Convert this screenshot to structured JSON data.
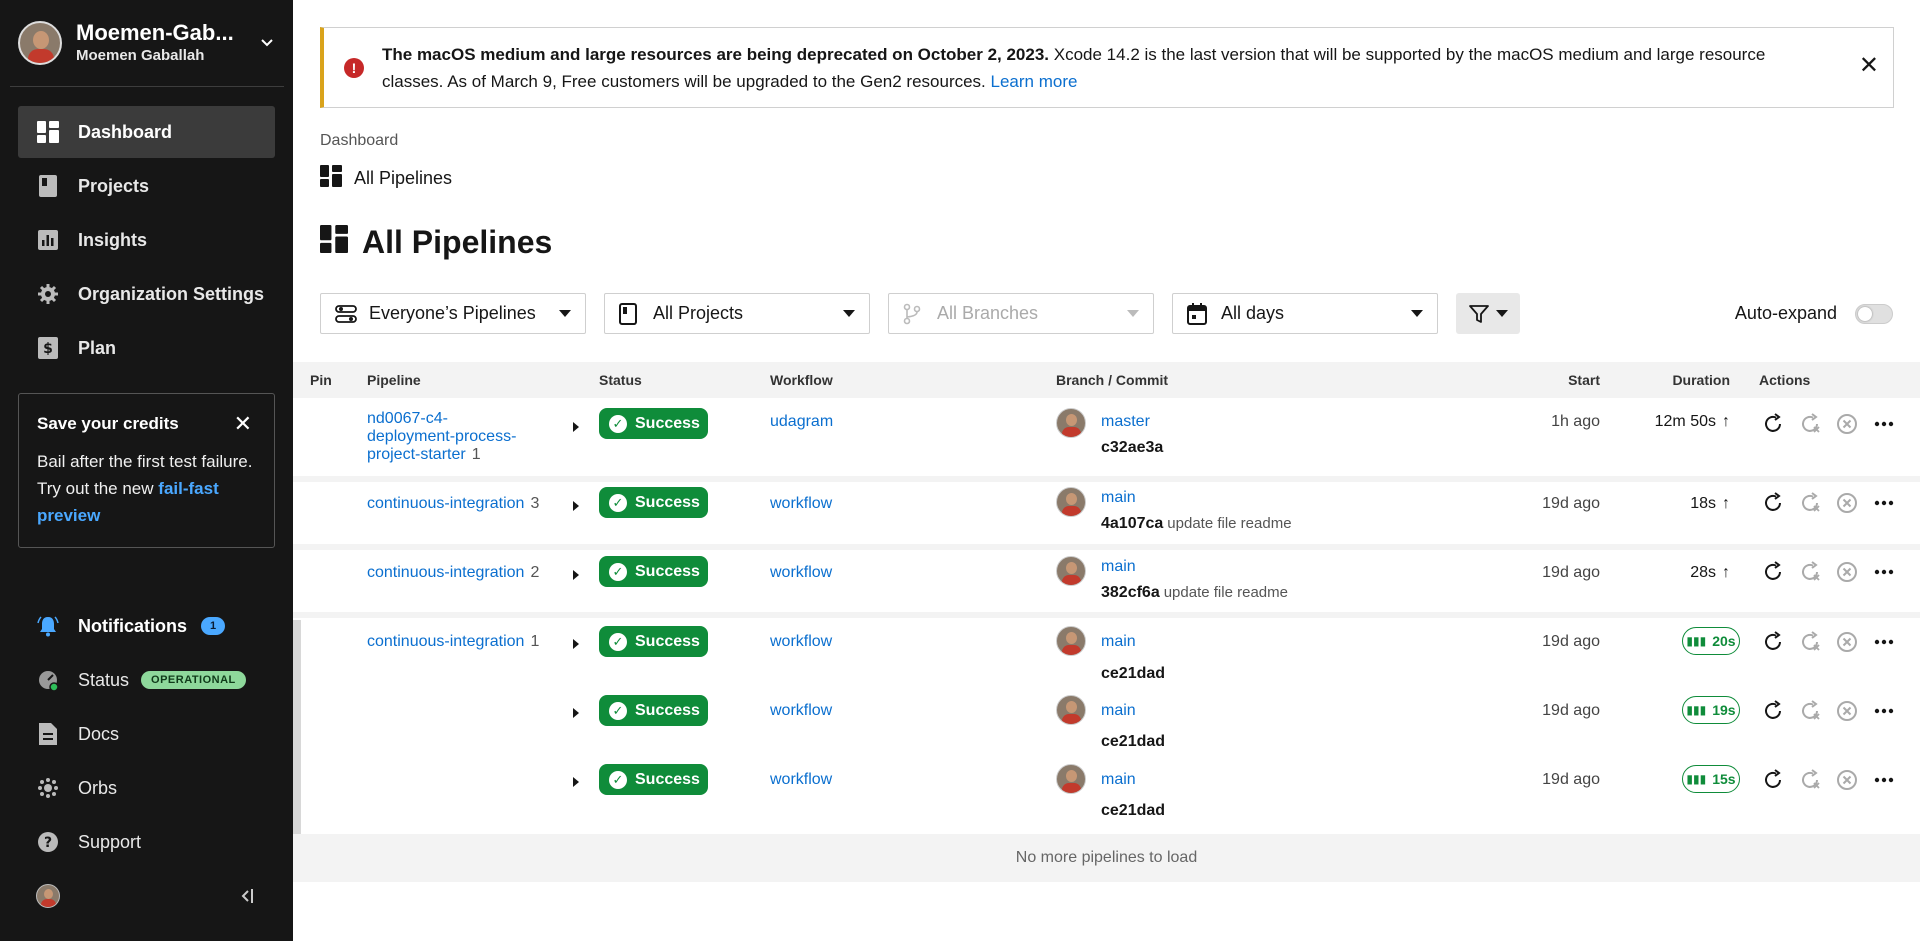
{
  "sidebar": {
    "org_name": "Moemen-Gab...",
    "user_name": "Moemen Gaballah",
    "nav": [
      {
        "label": "Dashboard",
        "icon": "dashboard-icon"
      },
      {
        "label": "Projects",
        "icon": "projects-icon"
      },
      {
        "label": "Insights",
        "icon": "insights-icon"
      },
      {
        "label": "Organization Settings",
        "icon": "gear-icon"
      },
      {
        "label": "Plan",
        "icon": "dollar-icon"
      }
    ],
    "credits": {
      "title": "Save your credits",
      "body": "Bail after the first test failure. Try out the new",
      "link": "fail-fast preview"
    },
    "bottom_nav": [
      {
        "label": "Notifications",
        "count": "1"
      },
      {
        "label": "Status",
        "badge": "OPERATIONAL"
      },
      {
        "label": "Docs"
      },
      {
        "label": "Orbs"
      },
      {
        "label": "Support"
      }
    ]
  },
  "banner": {
    "bold": "The macOS medium and large resources are being deprecated on October 2, 2023.",
    "text": " Xcode 14.2 is the last version that will be supported by the macOS medium and large resource classes. As of March 9, Free customers will be upgraded to the Gen2 resources. ",
    "link": "Learn more"
  },
  "breadcrumb": "Dashboard",
  "subtitle": "All Pipelines",
  "title": "All Pipelines",
  "filters": {
    "pipelines": "Everyone’s Pipelines",
    "projects": "All Projects",
    "branches": "All Branches",
    "days": "All days"
  },
  "auto_expand": "Auto-expand",
  "columns": {
    "pin": "Pin",
    "pipeline": "Pipeline",
    "status": "Status",
    "workflow": "Workflow",
    "branch": "Branch / Commit",
    "start": "Start",
    "duration": "Duration",
    "actions": "Actions"
  },
  "rows": [
    {
      "pipeline": "nd0067-c4-deployment-process-project-starter",
      "num": "1",
      "status": "Success",
      "workflow": "udagram",
      "branch": "master",
      "commit": "c32ae3a",
      "msg": "",
      "start": "1h ago",
      "duration": "12m 50s"
    },
    {
      "pipeline": "continuous-integration",
      "num": "3",
      "status": "Success",
      "workflow": "workflow",
      "branch": "main",
      "commit": "4a107ca",
      "msg": "update file readme",
      "start": "19d ago",
      "duration": "18s"
    },
    {
      "pipeline": "continuous-integration",
      "num": "2",
      "status": "Success",
      "workflow": "workflow",
      "branch": "main",
      "commit": "382cf6a",
      "msg": "update file readme",
      "start": "19d ago",
      "duration": "28s"
    },
    {
      "pipeline": "continuous-integration",
      "num": "1",
      "status": "Success",
      "workflow": "workflow",
      "branch": "main",
      "commit": "ce21dad",
      "msg": "",
      "start": "19d ago",
      "duration": "20s"
    },
    {
      "pipeline": "",
      "num": "",
      "status": "Success",
      "workflow": "workflow",
      "branch": "main",
      "commit": "ce21dad",
      "msg": "",
      "start": "19d ago",
      "duration": "19s"
    },
    {
      "pipeline": "",
      "num": "",
      "status": "Success",
      "workflow": "workflow",
      "branch": "main",
      "commit": "ce21dad",
      "msg": "",
      "start": "19d ago",
      "duration": "15s"
    }
  ],
  "footer": "No more pipelines to load",
  "colors": {
    "accent": "#0b6fcf",
    "success": "#0f8c3a",
    "sidebar": "#161616",
    "warning_border": "#d9a31b",
    "error": "#c62828"
  }
}
